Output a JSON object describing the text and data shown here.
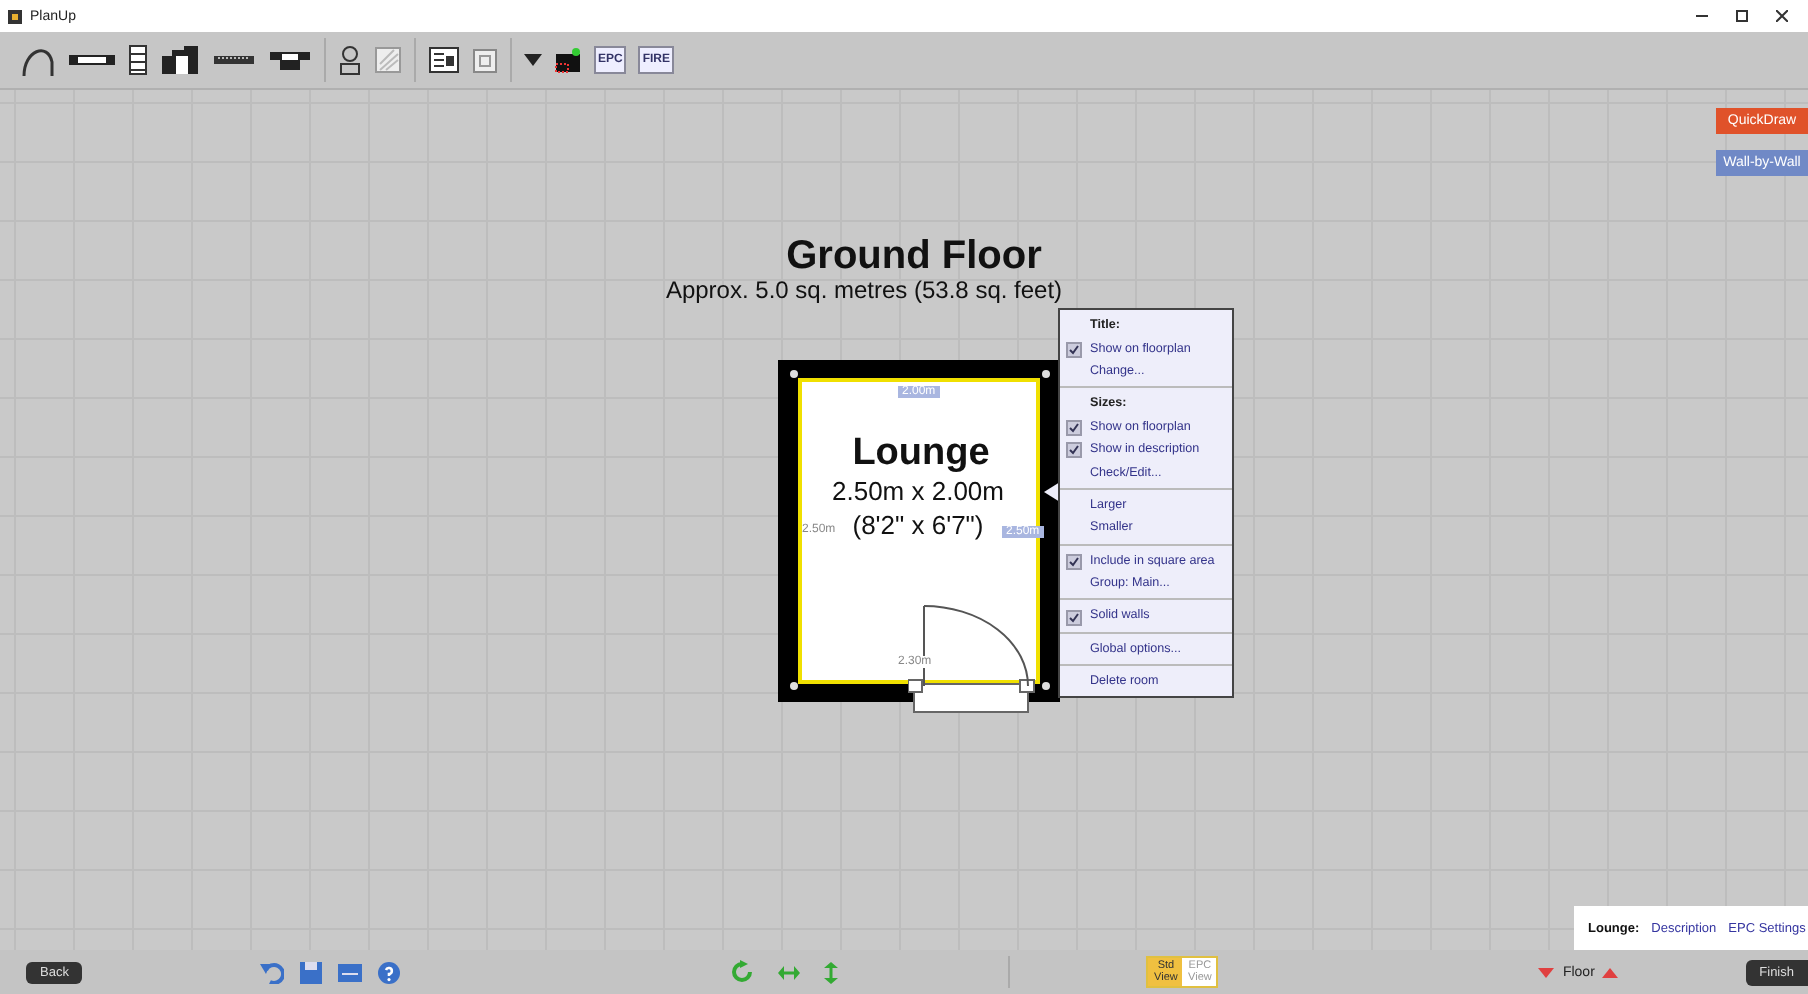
{
  "window": {
    "title": "PlanUp"
  },
  "toolbar": {
    "text_buttons": [
      "EPC",
      "FIRE"
    ]
  },
  "canvas_buttons": [
    {
      "label": "QuickDraw",
      "color": "#e0522a"
    },
    {
      "label": "Wall-by-Wall",
      "color": "#7089c6"
    }
  ],
  "floor": {
    "title": "Ground Floor",
    "area": "Approx. 5.0 sq. metres (53.8 sq. feet)"
  },
  "room": {
    "name": "Lounge",
    "size_metric": "2.50m x 2.00m",
    "size_imperial": "(8'2\" x 6'7\")",
    "dim_top": "2.00m",
    "dim_right": "2.50m",
    "dim_left": "2.50m",
    "dim_bottom": "2.30m"
  },
  "context_menu": {
    "sections": [
      [
        {
          "kind": "header",
          "label": "Title:"
        },
        {
          "kind": "check",
          "label": "Show on floorplan",
          "checked": true
        },
        {
          "kind": "action",
          "label": "Change..."
        }
      ],
      [
        {
          "kind": "header",
          "label": "Sizes:"
        },
        {
          "kind": "check",
          "label": "Show on floorplan",
          "checked": true
        },
        {
          "kind": "check",
          "label": "Show in description",
          "checked": true
        },
        {
          "kind": "action",
          "label": "Check/Edit..."
        }
      ],
      [
        {
          "kind": "action",
          "label": "Larger"
        },
        {
          "kind": "action",
          "label": "Smaller"
        }
      ],
      [
        {
          "kind": "check",
          "label": "Include in square area",
          "checked": true
        },
        {
          "kind": "action",
          "label": "Group: Main..."
        }
      ],
      [
        {
          "kind": "check",
          "label": "Solid walls",
          "checked": true
        }
      ],
      [
        {
          "kind": "action",
          "label": "Global options..."
        }
      ],
      [
        {
          "kind": "action",
          "label": "Delete room"
        }
      ]
    ]
  },
  "info_panel": {
    "room": "Lounge:",
    "links": [
      "Description",
      "EPC Settings"
    ]
  },
  "bottom_bar": {
    "back": "Back",
    "view_toggle": [
      {
        "label": "Std View",
        "selected": true
      },
      {
        "label": "EPC View",
        "selected": false
      }
    ],
    "floor": "Floor",
    "finish": "Finish"
  }
}
